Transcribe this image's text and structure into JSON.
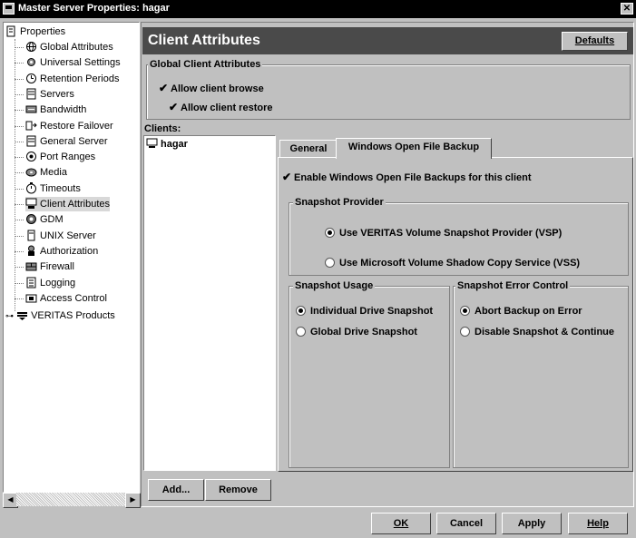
{
  "window": {
    "title": "Master Server Properties: hagar"
  },
  "tree": {
    "root": "Properties",
    "items": [
      {
        "label": "Global Attributes",
        "icon": "globe-icon"
      },
      {
        "label": "Universal Settings",
        "icon": "settings-icon"
      },
      {
        "label": "Retention Periods",
        "icon": "clock-icon"
      },
      {
        "label": "Servers",
        "icon": "server-icon"
      },
      {
        "label": "Bandwidth",
        "icon": "bandwidth-icon"
      },
      {
        "label": "Restore Failover",
        "icon": "failover-icon"
      },
      {
        "label": "General Server",
        "icon": "server-icon"
      },
      {
        "label": "Port Ranges",
        "icon": "port-icon"
      },
      {
        "label": "Media",
        "icon": "media-icon"
      },
      {
        "label": "Timeouts",
        "icon": "timer-icon"
      },
      {
        "label": "Client Attributes",
        "icon": "client-icon"
      },
      {
        "label": "GDM",
        "icon": "gdm-icon"
      },
      {
        "label": "UNIX Server",
        "icon": "unix-server-icon"
      },
      {
        "label": "Authorization",
        "icon": "authorization-icon"
      },
      {
        "label": "Firewall",
        "icon": "firewall-icon"
      },
      {
        "label": "Logging",
        "icon": "logging-icon"
      },
      {
        "label": "Access Control",
        "icon": "access-control-icon"
      }
    ],
    "veritas": "VERITAS Products"
  },
  "header": {
    "title": "Client Attributes",
    "defaults_button": "Defaults"
  },
  "global_attrs": {
    "group_title": "Global Client Attributes",
    "allow_browse": "Allow client browse",
    "allow_restore": "Allow client restore"
  },
  "clients": {
    "label": "Clients:",
    "items": [
      "hagar"
    ],
    "add_button": "Add...",
    "remove_button": "Remove"
  },
  "tabs": {
    "general": "General",
    "wofb": "Windows Open File Backup"
  },
  "wofb": {
    "enable_label": "Enable Windows Open File Backups for this client",
    "provider_title": "Snapshot Provider",
    "provider_vsp": "Use VERITAS Volume Snapshot Provider (VSP)",
    "provider_vss": "Use Microsoft Volume Shadow Copy Service (VSS)",
    "usage_title": "Snapshot Usage",
    "usage_individual": "Individual Drive Snapshot",
    "usage_global": "Global Drive Snapshot",
    "error_title": "Snapshot Error Control",
    "error_abort": "Abort Backup on Error",
    "error_disable": "Disable Snapshot & Continue"
  },
  "footer": {
    "ok": "OK",
    "cancel": "Cancel",
    "apply": "Apply",
    "help": "Help"
  }
}
